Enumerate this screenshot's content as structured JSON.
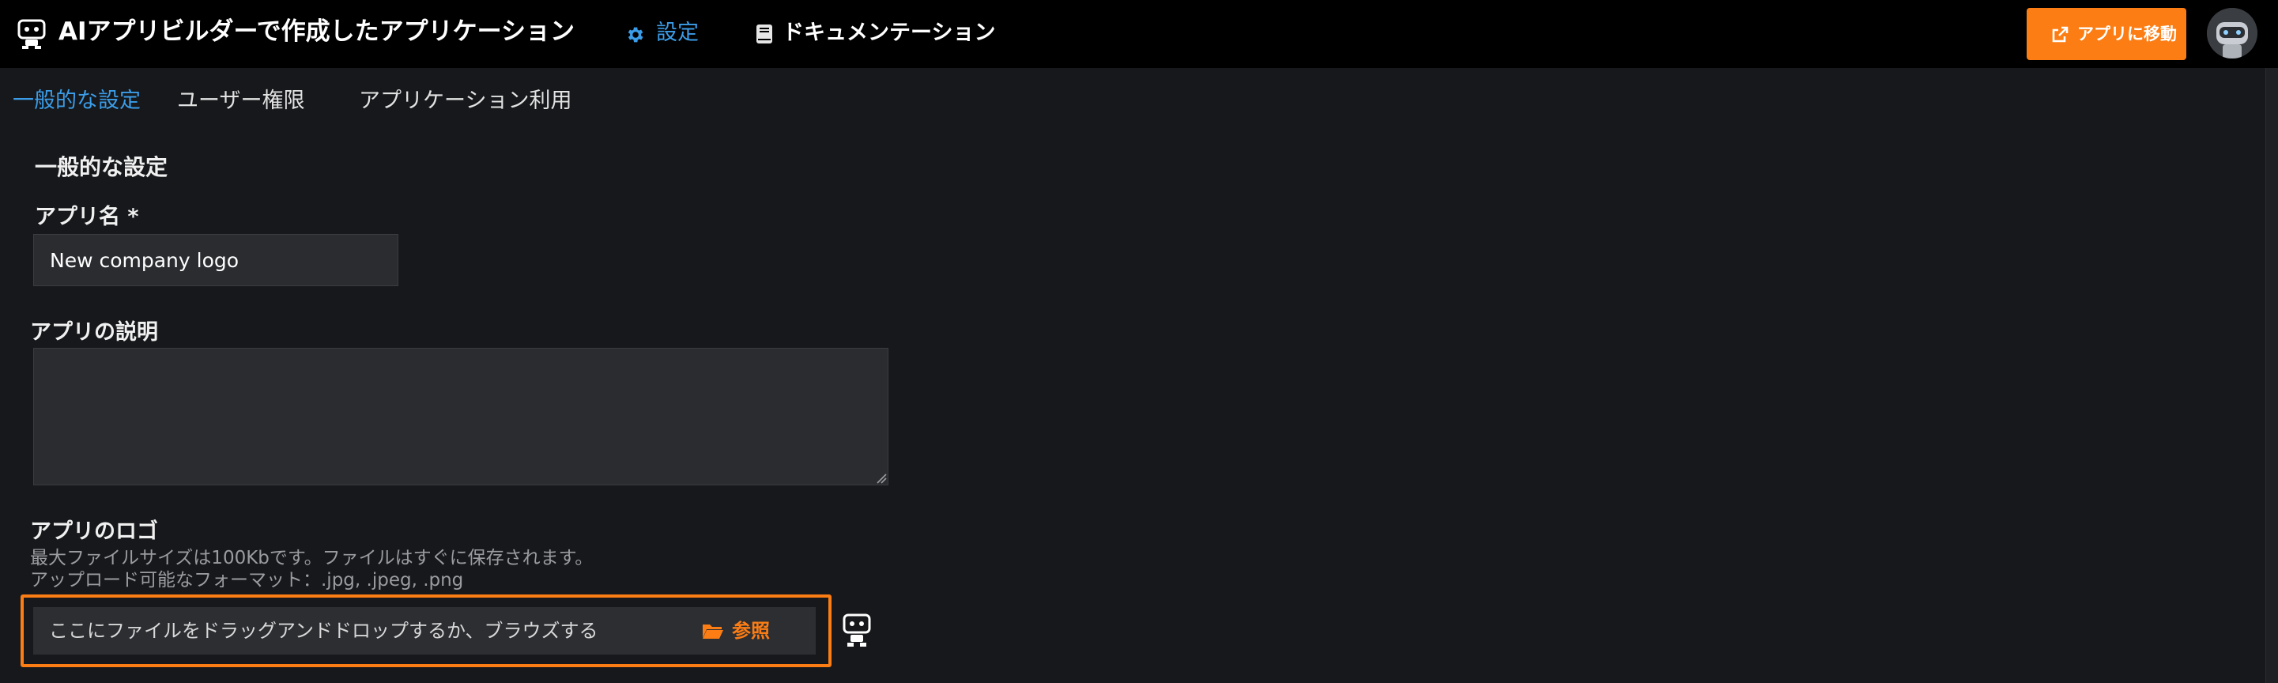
{
  "header": {
    "app_title": "AIアプリビルダーで作成したアプリケーション",
    "app_icon": "robot-icon",
    "nav": {
      "settings_label": "設定",
      "settings_icon": "gear-icon",
      "docs_label": "ドキュメンテーション",
      "docs_icon": "book-icon"
    },
    "goto_app_label": "アプリに移動",
    "goto_app_icon": "external-link-icon",
    "avatar_icon": "robot-avatar-icon"
  },
  "tabs": [
    {
      "label": "一般的な設定",
      "active": true
    },
    {
      "label": "ユーザー権限",
      "active": false
    },
    {
      "label": "アプリケーション利用",
      "active": false
    }
  ],
  "main": {
    "section_title": "一般的な設定",
    "app_name": {
      "label": "アプリ名 *",
      "value": "New company logo"
    },
    "app_description": {
      "label": "アプリの説明",
      "value": ""
    },
    "app_logo": {
      "label": "アプリのロゴ",
      "hint_size": "最大ファイルサイズは100Kbです。ファイルはすぐに保存されます。",
      "hint_formats": "アップロード可能なフォーマット：.jpg, .jpeg, .png",
      "drop_text": "ここにファイルをドラッグアンドドロップするか、ブラウズする",
      "browse_label": "参照",
      "browse_icon": "folder-open-icon",
      "preview_icon": "robot-logo-icon"
    }
  },
  "colors": {
    "accent_orange": "#fb7d14",
    "accent_blue": "#3b9de8",
    "background": "#16181b",
    "topbar": "#000000"
  }
}
